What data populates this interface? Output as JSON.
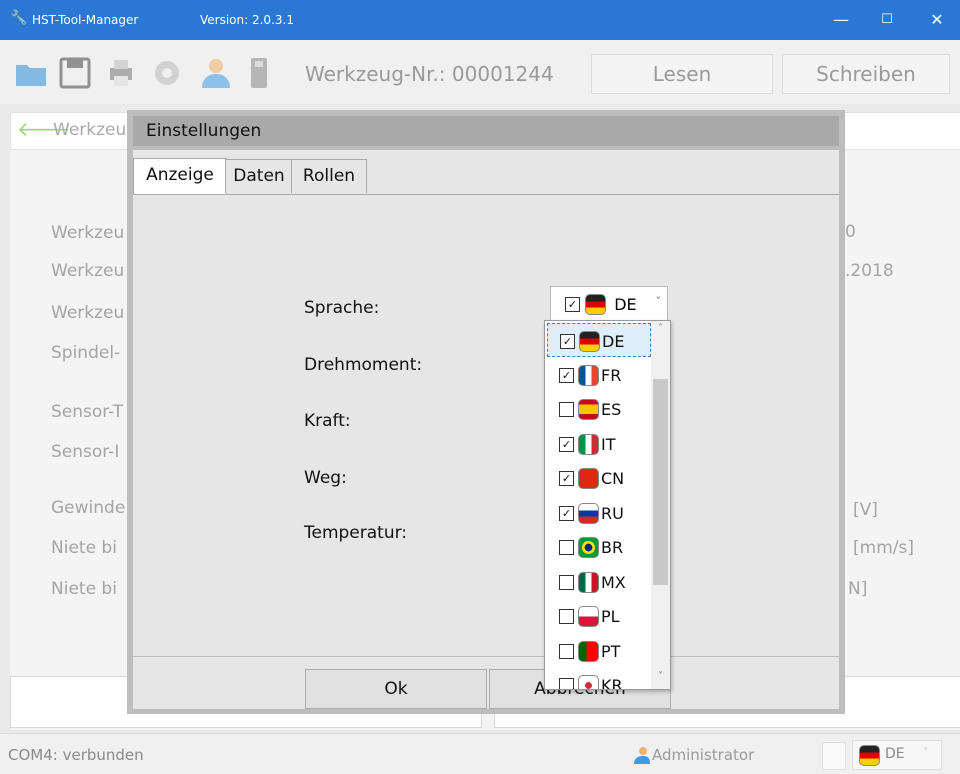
{
  "window": {
    "app_name": "HST-Tool-Manager",
    "version": "Version: 2.0.3.1",
    "min": "—",
    "max": "☐",
    "close": "✕"
  },
  "toolbar": {
    "werkzeug_nr": "Werkzeug-Nr.: 00001244",
    "lesen": "Lesen",
    "schreiben": "Schreiben"
  },
  "back": {
    "label": "Werkzeu"
  },
  "background": {
    "rows": [
      "Werkzeu",
      "Werkzeu",
      "Werkzeu",
      "Spindel-",
      "Sensor-T",
      "Sensor-I",
      "Gewinde",
      "Niete bi",
      "Niete bi"
    ],
    "right": [
      "0",
      ".2018",
      "[V]",
      "[mm/s]",
      "N]"
    ]
  },
  "dialog": {
    "title": "Einstellungen",
    "tabs": [
      "Anzeige",
      "Daten",
      "Rollen"
    ],
    "fields": [
      "Sprache:",
      "Drehmoment:",
      "Kraft:",
      "Weg:",
      "Temperatur:"
    ],
    "language_combo": {
      "checked": true,
      "code": "DE"
    },
    "ok": "Ok",
    "cancel": "Abbrechen"
  },
  "language_list": [
    {
      "code": "DE",
      "checked": true
    },
    {
      "code": "FR",
      "checked": true
    },
    {
      "code": "ES",
      "checked": false
    },
    {
      "code": "IT",
      "checked": true
    },
    {
      "code": "CN",
      "checked": true
    },
    {
      "code": "RU",
      "checked": true
    },
    {
      "code": "BR",
      "checked": false
    },
    {
      "code": "MX",
      "checked": false
    },
    {
      "code": "PL",
      "checked": false
    },
    {
      "code": "PT",
      "checked": false
    },
    {
      "code": "KR",
      "checked": false
    }
  ],
  "status": {
    "connection": "COM4: verbunden",
    "user": "Administrator",
    "lang_code": "DE"
  },
  "colors": {
    "titlebar": "#2b78d4",
    "accent": "#3a7ed6"
  }
}
